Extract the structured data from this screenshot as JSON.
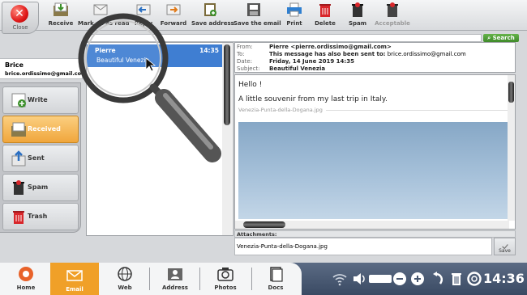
{
  "toolbar": {
    "close_label": "Close",
    "receive_label": "Receive",
    "mark_all_read_label": "Mark all as read",
    "reply_label": "Reply",
    "forward_label": "Forward",
    "save_address_label": "Save address",
    "save_email_label": "Save the email",
    "print_label": "Print",
    "delete_label": "Delete",
    "spam_label": "Spam",
    "acceptable_label": "Acceptable"
  },
  "user": {
    "name": "Brice",
    "email": "brice.ordissimo@gmail.com"
  },
  "folders": [
    {
      "label": "Write",
      "icon": "write-icon"
    },
    {
      "label": "Received",
      "icon": "received-icon",
      "active": true
    },
    {
      "label": "Sent",
      "icon": "sent-icon"
    },
    {
      "label": "Spam",
      "icon": "spam-icon"
    },
    {
      "label": "Trash",
      "icon": "trash-icon"
    }
  ],
  "search": {
    "placeholder": "",
    "button_label": "Search"
  },
  "message_list": [
    {
      "sender": "Pierre",
      "subject": "Beautiful Venezia",
      "time": "14:35",
      "selected": true
    }
  ],
  "message": {
    "from_label": "From:",
    "from": "Pierre <pierre.ordissimo@gmail.com>",
    "to_label": "To:",
    "to_prefix": "This message has also been sent to:",
    "to": "brice.ordissimo@gmail.com",
    "date_label": "Date:",
    "date": "Friday, 14 June 2019 14:35",
    "subject_label": "Subject:",
    "subject": "Beautiful Venezia",
    "greeting": "Hello !",
    "body": "A little souvenir from my last trip in Italy.",
    "image_caption": "Venezia-Punta-della-Dogana.jpg"
  },
  "attachments": {
    "label": "Attachments:",
    "file": "Venezia-Punta-della-Dogana.jpg",
    "save_label": "Save"
  },
  "bottom_bar": {
    "items": [
      {
        "label": "Home",
        "icon": "home-icon"
      },
      {
        "label": "Email",
        "icon": "email-icon",
        "active": true
      },
      {
        "label": "Web",
        "icon": "web-icon"
      },
      {
        "label": "Address",
        "icon": "address-icon"
      },
      {
        "label": "Photos",
        "icon": "photos-icon"
      },
      {
        "label": "Docs",
        "icon": "docs-icon"
      }
    ],
    "clock": "14:36"
  },
  "colors": {
    "accent_orange": "#f0a028",
    "selection_blue": "#3f7ed2",
    "search_green": "#4f9e35",
    "taskbar_blue": "#46566f"
  }
}
